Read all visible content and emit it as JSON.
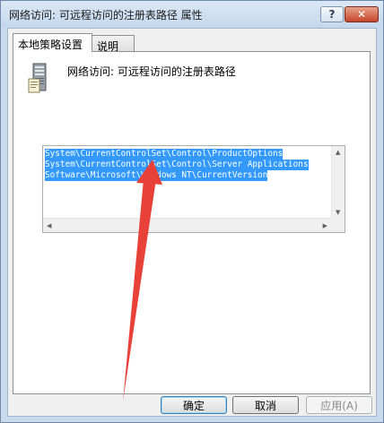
{
  "window": {
    "title": "网络访问: 可远程访问的注册表路径 属性",
    "help_glyph": "?",
    "close_glyph": "✕"
  },
  "tabs": [
    {
      "label": "本地策略设置",
      "active": true
    },
    {
      "label": "说明",
      "active": false
    }
  ],
  "policy": {
    "icon": "server-icon",
    "name": "网络访问: 可远程访问的注册表路径"
  },
  "registry_paths": [
    "System\\CurrentControlSet\\Control\\ProductOptions",
    "System\\CurrentControlSet\\Control\\Server Applications",
    "Software\\Microsoft\\Windows NT\\CurrentVersion"
  ],
  "buttons": {
    "ok": "确定",
    "cancel": "取消",
    "apply": "应用(A)"
  },
  "colors": {
    "selection": "#3399ff",
    "annotation_arrow": "#e8413a"
  }
}
